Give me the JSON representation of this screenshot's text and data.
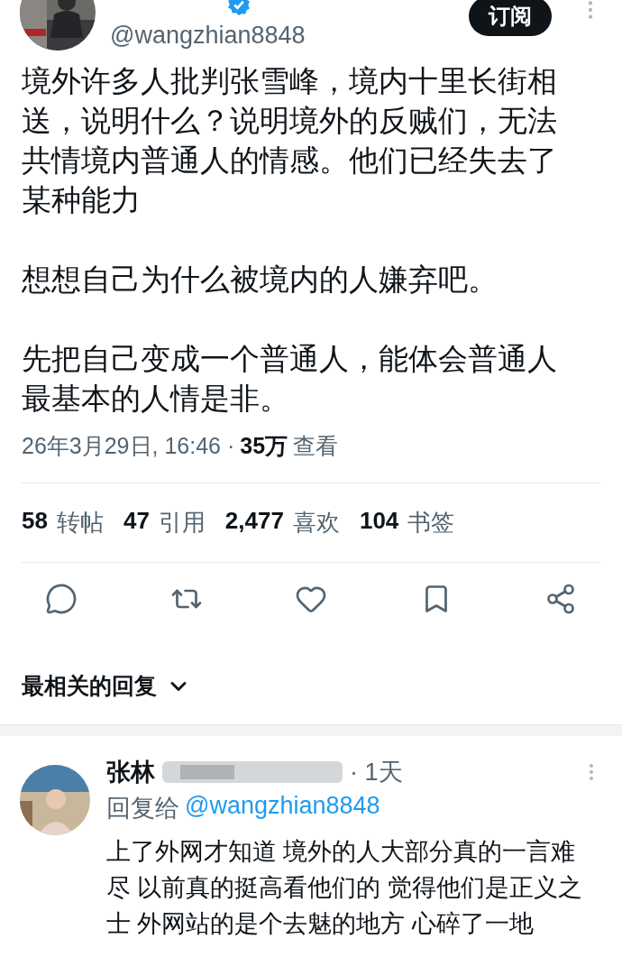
{
  "post": {
    "handle": "@wangzhian8848",
    "verified": true,
    "subscribe_button": "订阅",
    "paragraphs": [
      "境外许多人批判张雪峰，境内十里长街相送，说明什么？说明境外的反贼们，无法共情境内普通人的情感。他们已经失去了某种能力",
      "想想自己为什么被境内的人嫌弃吧。",
      "先把自己变成一个普通人，能体会普通人最基本的人情是非。"
    ],
    "timestamp": "26年3月29日, 16:46 · ",
    "views_count": "35万",
    "views_label": "查看",
    "stats": [
      {
        "count": "58",
        "label": "转帖"
      },
      {
        "count": "47",
        "label": "引用"
      },
      {
        "count": "2,477",
        "label": "喜欢"
      },
      {
        "count": "104",
        "label": "书签"
      }
    ],
    "actions": [
      {
        "kind": "reply"
      },
      {
        "kind": "repost"
      },
      {
        "kind": "like"
      },
      {
        "kind": "bookmark"
      },
      {
        "kind": "share"
      }
    ]
  },
  "replies_sort": "最相关的回复",
  "replies": [
    {
      "name": "张林",
      "time": "· 1天",
      "replying_to_label": "回复给",
      "replying_to": "@wangzhian8848",
      "text": "上了外网才知道 境外的人大部分真的一言难尽 以前真的挺高看他们的 觉得他们是正义之士 外网站的是个去魅的地方 心碎了一地"
    }
  ]
}
